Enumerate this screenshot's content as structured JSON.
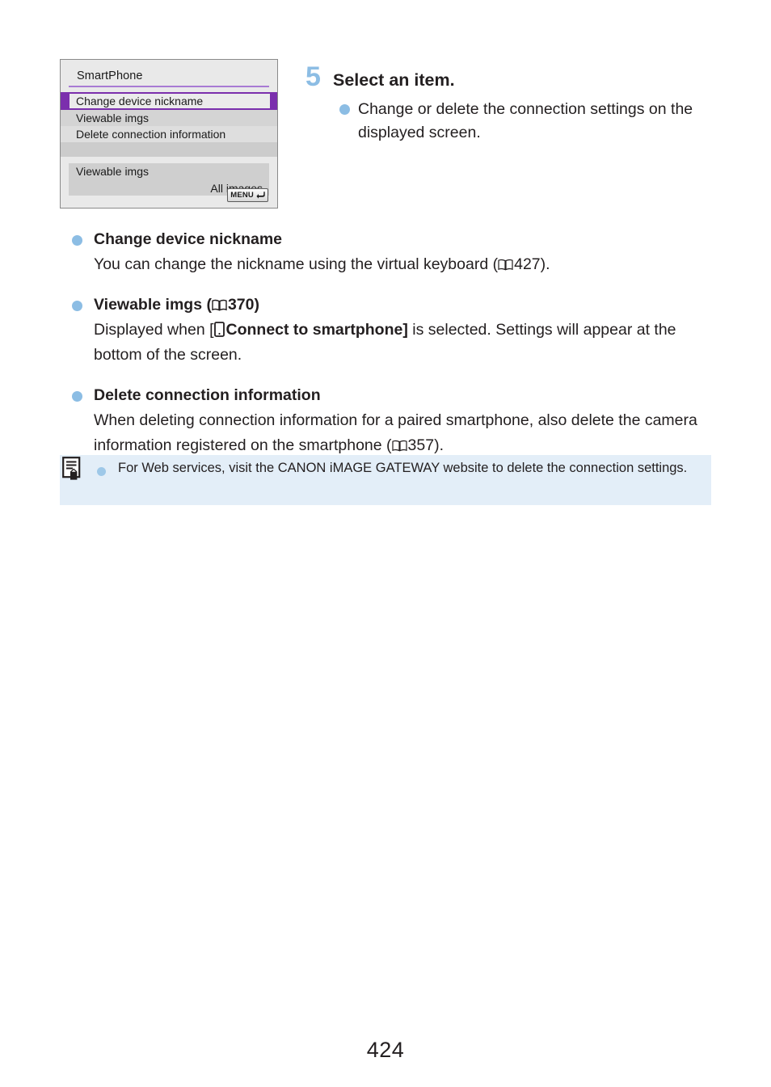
{
  "figure": {
    "name": "camera-menu-screen",
    "title": "SmartPhone",
    "menu_items": [
      {
        "label": "Change device nickname",
        "selected": true
      },
      {
        "label": "Viewable imgs",
        "selected": false
      },
      {
        "label": "Delete connection information",
        "selected": false
      }
    ],
    "sub_panel": {
      "label": "Viewable imgs",
      "value": "All images"
    },
    "menu_button": {
      "label": "MENU",
      "icon": "return-arrow-icon"
    },
    "colors": {
      "selection": "#7b2fad",
      "screen_bg": "#e9e9e9",
      "row_alt": "#d4d4d4"
    }
  },
  "step": {
    "number": "5",
    "title": "Select an item.",
    "bullet_text": "Change or delete the connection settings on the displayed screen.",
    "accent_color": "#8cbde4"
  },
  "sections": [
    {
      "title": "Change device nickname",
      "title_ref": "",
      "para_before": "You can change the nickname using the virtual keyboard (",
      "para_ref": "427",
      "para_after": ")."
    },
    {
      "title": "Viewable imgs (",
      "title_ref": "370",
      "title_after": ")",
      "para_before": "Displayed when [",
      "para_bold": "Connect to smartphone]",
      "para_after": " is selected. Settings will appear at the bottom of the screen."
    },
    {
      "title": "Delete connection information",
      "para_before": "When deleting connection information for a paired smartphone, also delete the camera information registered on the smartphone (",
      "para_ref": "357",
      "para_after": ")."
    }
  ],
  "note": {
    "icon": "note-memo-icon",
    "text": "For Web services, visit the CANON iMAGE GATEWAY website to delete the connection settings.",
    "background": "#e3eef8"
  },
  "page_number": "424"
}
